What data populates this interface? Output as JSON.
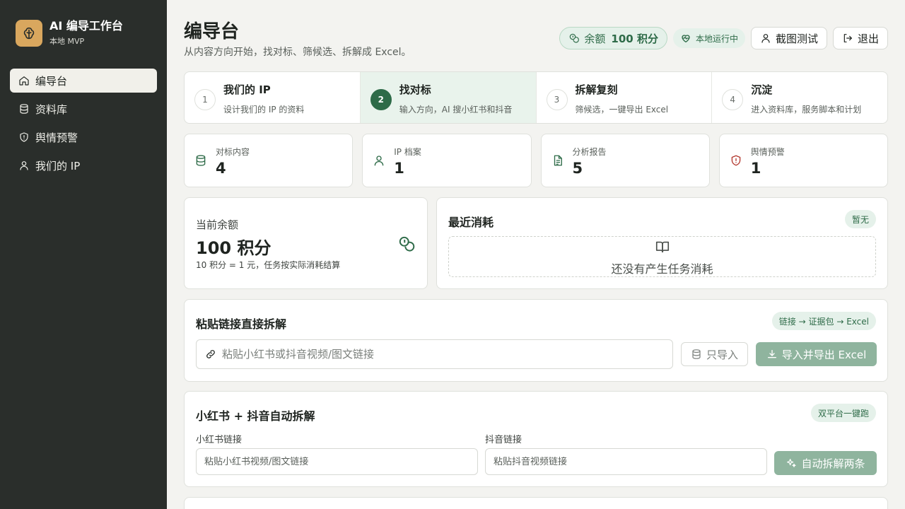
{
  "brand": {
    "title": "AI 编导工作台",
    "subtitle": "本地 MVP"
  },
  "nav": [
    {
      "label": "编导台",
      "icon": "home-icon",
      "active": true
    },
    {
      "label": "资料库",
      "icon": "database-icon"
    },
    {
      "label": "舆情预警",
      "icon": "shield-alert-icon"
    },
    {
      "label": "我们的 IP",
      "icon": "user-icon"
    }
  ],
  "header": {
    "title": "编导台",
    "subtitle": "从内容方向开始，找对标、筛候选、拆解成 Excel。",
    "balance_label": "余额",
    "balance_value": "100 积分",
    "status": "本地运行中",
    "user_button": "截图测试",
    "logout_button": "退出"
  },
  "steps": [
    {
      "num": "1",
      "title": "我们的 IP",
      "desc": "设计我们的 IP 的资料"
    },
    {
      "num": "2",
      "title": "找对标",
      "desc": "输入方向，AI 搜小红书和抖音",
      "active": true
    },
    {
      "num": "3",
      "title": "拆解复刻",
      "desc": "筛候选，一键导出 Excel"
    },
    {
      "num": "4",
      "title": "沉淀",
      "desc": "进入资料库，服务脚本和计划"
    }
  ],
  "stats": [
    {
      "label": "对标内容",
      "value": "4",
      "icon": "database-icon"
    },
    {
      "label": "IP 档案",
      "value": "1",
      "icon": "user-icon"
    },
    {
      "label": "分析报告",
      "value": "5",
      "icon": "file-text-icon"
    },
    {
      "label": "舆情预警",
      "value": "1",
      "icon": "shield-alert-icon"
    }
  ],
  "balance_card": {
    "label": "当前余额",
    "value": "100 积分",
    "note": "10 积分 = 1 元，任务按实际消耗结算"
  },
  "recent_card": {
    "title": "最近消耗",
    "tag": "暂无",
    "empty": "还没有产生任务消耗"
  },
  "paste_card": {
    "title": "粘贴链接直接拆解",
    "tag": "链接 → 证据包 → Excel",
    "placeholder": "粘贴小红书或抖音视频/图文链接",
    "import_only": "只导入",
    "import_export": "导入并导出 Excel"
  },
  "auto_card": {
    "title": "小红书 + 抖音自动拆解",
    "tag": "双平台一键跑",
    "xhs_label": "小红书链接",
    "xhs_placeholder": "粘贴小红书视频/图文链接",
    "dy_label": "抖音链接",
    "dy_placeholder": "粘贴抖音视频链接",
    "button": "自动拆解两条"
  },
  "colors": {
    "sidebar": "#2a2e2b",
    "accent": "#2e6b48",
    "accent_light": "#e5f1ea",
    "brand": "#d9a75e"
  }
}
